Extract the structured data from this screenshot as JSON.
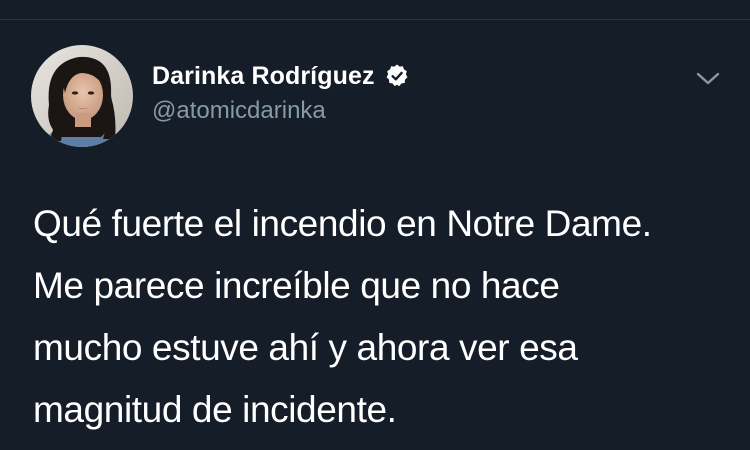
{
  "tweet": {
    "author": {
      "display_name": "Darinka Rodríguez",
      "handle": "@atomicdarinka",
      "verified": true,
      "avatar_icon": "profile-photo",
      "verified_icon": "verified-badge-icon"
    },
    "menu_icon": "chevron-down-icon",
    "text_lines": [
      "Qué fuerte el incendio en Notre Dame.",
      "Me parece increíble que no hace",
      "mucho estuve ahí y ahora ver esa",
      "magnitud de incidente."
    ]
  },
  "colors": {
    "background": "#151d29",
    "text_primary": "#ffffff",
    "text_secondary": "#8899a6",
    "divider": "#2a3441"
  }
}
